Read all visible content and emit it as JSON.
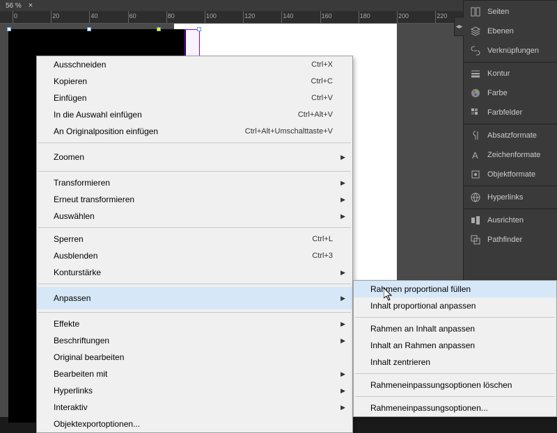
{
  "topbar": {
    "zoom": "56 %",
    "close": "×"
  },
  "ruler": {
    "ticks": [
      0,
      20,
      40,
      60,
      80,
      100,
      120,
      140,
      160,
      180,
      200,
      220
    ]
  },
  "panels": {
    "groups": [
      [
        {
          "name": "seiten",
          "label": "Seiten",
          "icon": "pages"
        },
        {
          "name": "ebenen",
          "label": "Ebenen",
          "icon": "layers"
        },
        {
          "name": "verknuepfungen",
          "label": "Verknüpfungen",
          "icon": "links"
        }
      ],
      [
        {
          "name": "kontur",
          "label": "Kontur",
          "icon": "stroke"
        },
        {
          "name": "farbe",
          "label": "Farbe",
          "icon": "color"
        },
        {
          "name": "farbfelder",
          "label": "Farbfelder",
          "icon": "swatches"
        }
      ],
      [
        {
          "name": "absatzformate",
          "label": "Absatzformate",
          "icon": "para"
        },
        {
          "name": "zeichenformate",
          "label": "Zeichenformate",
          "icon": "char"
        },
        {
          "name": "objektformate",
          "label": "Objektformate",
          "icon": "obj"
        }
      ],
      [
        {
          "name": "hyperlinks",
          "label": "Hyperlinks",
          "icon": "hyper"
        }
      ],
      [
        {
          "name": "ausrichten",
          "label": "Ausrichten",
          "icon": "align"
        },
        {
          "name": "pathfinder",
          "label": "Pathfinder",
          "icon": "pathf"
        }
      ]
    ]
  },
  "menu1": [
    {
      "type": "item",
      "label": "Ausschneiden",
      "shortcut": "Ctrl+X"
    },
    {
      "type": "item",
      "label": "Kopieren",
      "shortcut": "Ctrl+C"
    },
    {
      "type": "item",
      "label": "Einfügen",
      "shortcut": "Ctrl+V"
    },
    {
      "type": "item",
      "label": "In die Auswahl einfügen",
      "shortcut": "Ctrl+Alt+V"
    },
    {
      "type": "item",
      "label": "An Originalposition einfügen",
      "shortcut": "Ctrl+Alt+Umschalttaste+V"
    },
    {
      "type": "sep"
    },
    {
      "type": "item",
      "label": "Zoomen",
      "sub": true,
      "tall": true
    },
    {
      "type": "sep"
    },
    {
      "type": "item",
      "label": "Transformieren",
      "sub": true
    },
    {
      "type": "item",
      "label": "Erneut transformieren",
      "sub": true
    },
    {
      "type": "item",
      "label": "Auswählen",
      "sub": true
    },
    {
      "type": "sep"
    },
    {
      "type": "item",
      "label": "Sperren",
      "shortcut": "Ctrl+L"
    },
    {
      "type": "item",
      "label": "Ausblenden",
      "shortcut": "Ctrl+3"
    },
    {
      "type": "item",
      "label": "Konturstärke",
      "sub": true
    },
    {
      "type": "sep"
    },
    {
      "type": "item",
      "label": "Anpassen",
      "sub": true,
      "hover": true,
      "tall": true
    },
    {
      "type": "sep"
    },
    {
      "type": "item",
      "label": "Effekte",
      "sub": true
    },
    {
      "type": "item",
      "label": "Beschriftungen",
      "sub": true
    },
    {
      "type": "item",
      "label": "Original bearbeiten"
    },
    {
      "type": "item",
      "label": "Bearbeiten mit",
      "sub": true
    },
    {
      "type": "item",
      "label": "Hyperlinks",
      "sub": true
    },
    {
      "type": "item",
      "label": "Interaktiv",
      "sub": true
    },
    {
      "type": "item",
      "label": "Objektexportoptionen..."
    }
  ],
  "menu2": [
    {
      "type": "item",
      "label": "Rahmen proportional füllen",
      "hover": true
    },
    {
      "type": "item",
      "label": "Inhalt proportional anpassen"
    },
    {
      "type": "sep"
    },
    {
      "type": "item",
      "label": "Rahmen an Inhalt anpassen"
    },
    {
      "type": "item",
      "label": "Inhalt an Rahmen anpassen"
    },
    {
      "type": "item",
      "label": "Inhalt zentrieren"
    },
    {
      "type": "sep"
    },
    {
      "type": "item",
      "label": "Rahmeneinpassungsoptionen löschen"
    },
    {
      "type": "sep"
    },
    {
      "type": "item",
      "label": "Rahmeneinpassungsoptionen..."
    }
  ]
}
